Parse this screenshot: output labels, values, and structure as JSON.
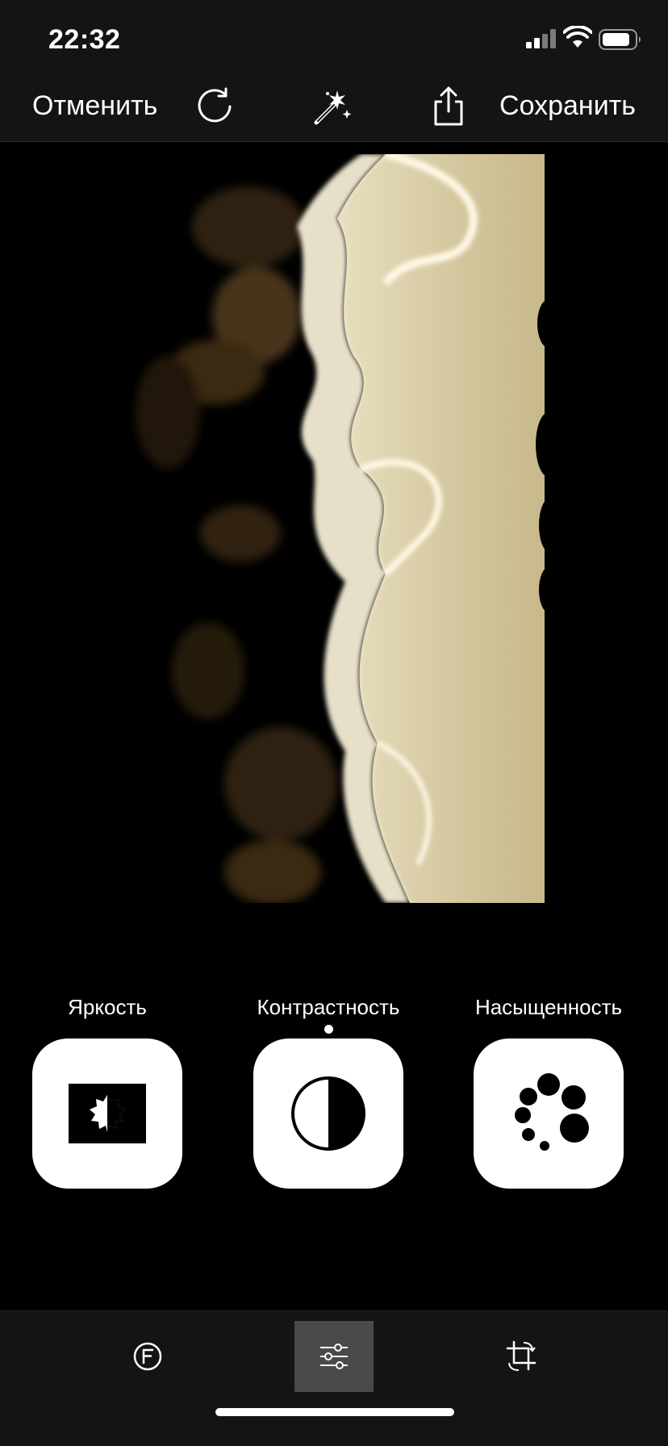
{
  "status_bar": {
    "time": "22:32",
    "icons": [
      "signal-icon",
      "wifi-icon",
      "battery-icon"
    ]
  },
  "toolbar": {
    "undo_label": "Отменить",
    "save_label": "Сохранить",
    "icons": [
      "reset-icon",
      "magic-wand-icon",
      "share-icon"
    ]
  },
  "photo": {
    "subject": "aerial beach with waves, sepia tone",
    "tint": "#cfc39c"
  },
  "adjustments": [
    {
      "label": "Яркость",
      "icon": "brightness-icon",
      "selected": false
    },
    {
      "label": "Контрастность",
      "icon": "contrast-icon",
      "selected": true
    },
    {
      "label": "Насыщенность",
      "icon": "saturation-icon",
      "selected": false
    }
  ],
  "tab_bar": {
    "tabs": [
      {
        "icon": "filters-icon",
        "active": false
      },
      {
        "icon": "sliders-icon",
        "active": true
      },
      {
        "icon": "crop-rotate-icon",
        "active": false
      }
    ]
  },
  "colors": {
    "bar_background": "#141414",
    "canvas_background": "#000000",
    "active_tab": "#4a4a4a",
    "tile_background": "#ffffff"
  }
}
